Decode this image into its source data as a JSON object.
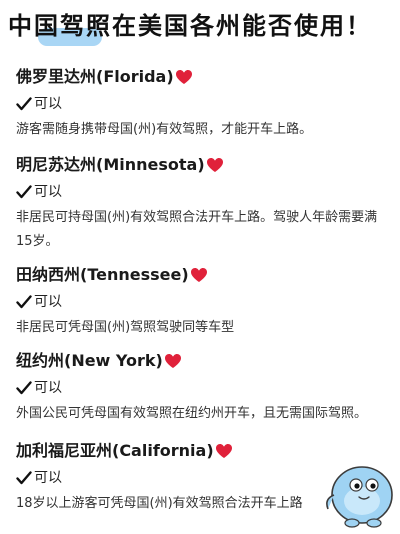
{
  "title": "中国驾照在美国各州能否使用！",
  "sections": [
    {
      "name": "佛罗里达州(Florida)",
      "status": "可以",
      "desc": "游客需随身携带母国(州)有效驾照，才能开车上路。"
    },
    {
      "name": "明尼苏达州(Minnesota)",
      "status": "可以",
      "desc": "非居民可持母国(州)有效驾照合法开车上路。驾驶人年龄需要满15岁。"
    },
    {
      "name": "田纳西州(Tennessee)",
      "status": "可以",
      "desc": "非居民可凭母国(州)驾照驾驶同等车型"
    },
    {
      "name": "纽约州(New York)",
      "status": "可以",
      "desc": "外国公民可凭母国有效驾照在纽约州开车，且无需国际驾照。"
    },
    {
      "name": "加利福尼亚州(California)",
      "status": "可以",
      "desc": "18岁以上游客可凭母国(州)有效驾照合法开车上路"
    }
  ],
  "colors": {
    "heart": "#e0213a",
    "highlight": "#a9d6f5"
  },
  "icons": {
    "heart": "heart-icon",
    "check": "checkmark-icon",
    "mascot": "mascot-icon"
  }
}
